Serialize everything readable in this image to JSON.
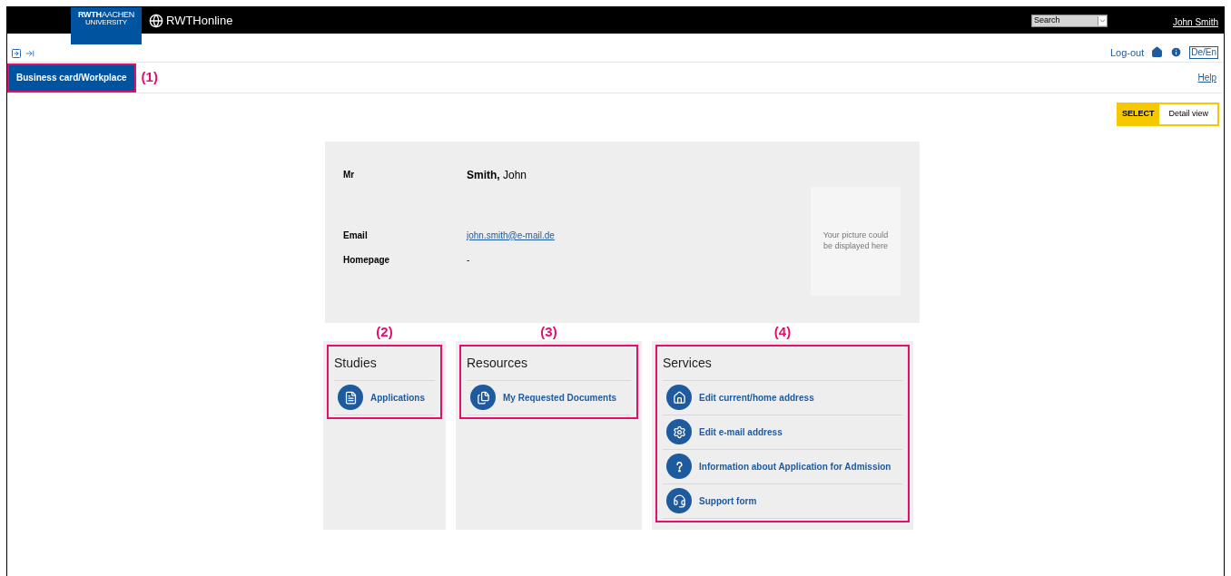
{
  "header": {
    "logo": {
      "line_1_bold": "RWTH",
      "line_1": "AACHEN",
      "line_2": "UNIVERSITY"
    },
    "app_name": "RWTHonline",
    "search_select": {
      "value": "Search"
    },
    "user_link": "John Smith"
  },
  "toolbar": {
    "logout_link": "Log-out",
    "language_toggle": "De/En"
  },
  "tabs": [
    {
      "label": "Business card/Workplace",
      "selected": true,
      "callout": "(1)"
    }
  ],
  "help_link": "Help",
  "view_switch": {
    "label": "SELECT",
    "options": [
      {
        "label": "Detail view",
        "selected": true
      }
    ]
  },
  "business_card": {
    "salutation": "Mr",
    "name": "**Smith,** John",
    "fields": [
      {
        "label": "Email",
        "value": "john.smith@e-mail.de",
        "kind": "link"
      },
      {
        "label": "Homepage",
        "value": "-",
        "kind": "text"
      }
    ],
    "picture_placeholder": "Your picture could be displayed here"
  },
  "panels": [
    {
      "title": "Studies",
      "callout": "(2)",
      "items": [
        {
          "label": "Applications",
          "kind": "document"
        }
      ]
    },
    {
      "title": "Resources",
      "callout": "(3)",
      "items": [
        {
          "label": "My Requested Documents",
          "kind": "documents"
        }
      ]
    },
    {
      "title": "Services",
      "callout": "(4)",
      "items": [
        {
          "label": "Edit current/home address",
          "kind": "house"
        },
        {
          "label": "Edit e-mail address",
          "kind": "gear"
        },
        {
          "label": "Information about Application for Admission",
          "kind": "question"
        },
        {
          "label": "Support form",
          "kind": "headset"
        }
      ]
    }
  ]
}
